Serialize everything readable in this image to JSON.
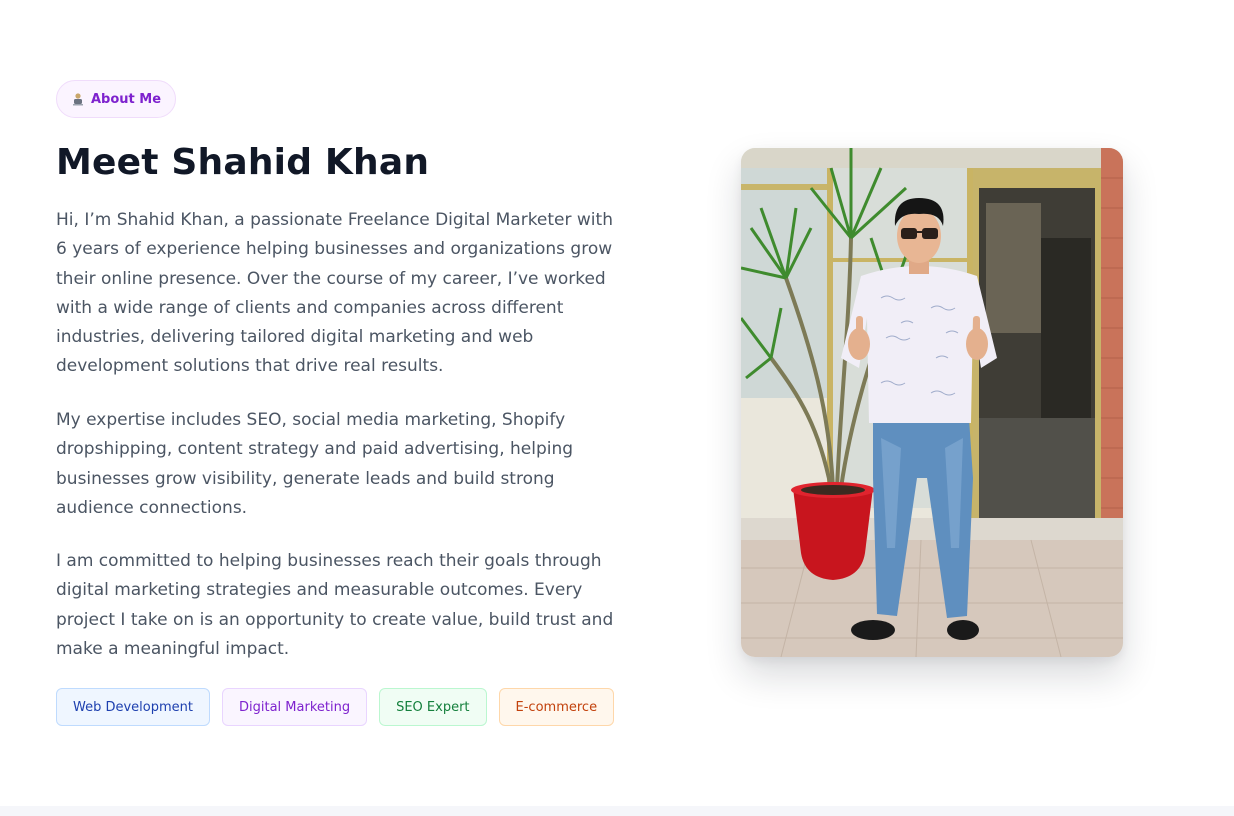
{
  "about": {
    "badge_label": "About Me",
    "badge_icon": "person-icon",
    "title": "Meet Shahid Khan",
    "paragraphs": [
      "Hi, I’m Shahid Khan, a passionate Freelance Digital Marketer with 6 years of experience helping businesses and organizations grow their online presence. Over the course of my career, I’ve worked with a wide range of clients and companies across different industries, delivering tailored digital marketing and web development solutions that drive real results.",
      "My expertise includes SEO, social media marketing, Shopify dropshipping, content strategy and paid advertising, helping businesses grow visibility, generate leads and build strong audience connections.",
      "I am committed to helping businesses reach their goals through digital marketing strategies and measurable outcomes. Every project I take on is an opportunity to create value, build trust and make a meaningful impact."
    ],
    "tags": [
      "Web Development",
      "Digital Marketing",
      "SEO Expert",
      "E-commerce"
    ]
  },
  "colors": {
    "accent_purple": "#7e22ce",
    "title": "#111827",
    "body_text": "#4b5563"
  }
}
